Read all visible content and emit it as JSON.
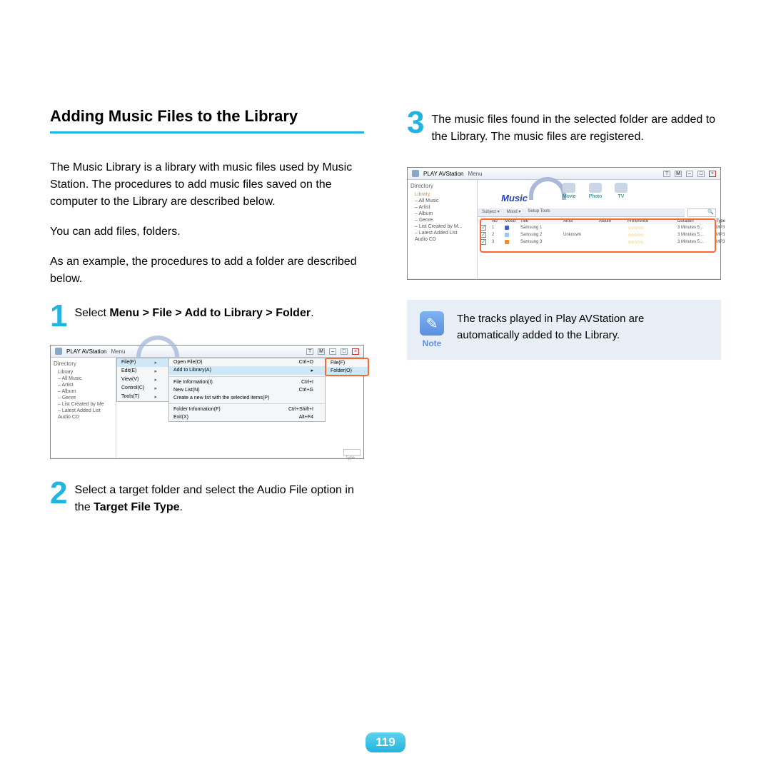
{
  "heading": "Adding Music Files to the Library",
  "intro1": "The Music Library is a library with music files used by Music Station. The procedures to add music files saved on the computer to the Library are described below.",
  "intro2": "You can add files, folders.",
  "intro3": "As an example, the procedures to add a folder are described below.",
  "step1": {
    "num": "1",
    "prefix": "Select ",
    "bold": "Menu > File > Add to Library > Folder",
    "suffix": "."
  },
  "step2": {
    "num": "2",
    "prefix": "Select a target folder and select the Audio File option in the ",
    "bold": "Target File Type",
    "suffix": "."
  },
  "step3": {
    "num": "3",
    "text": "The music files found in the selected folder are added to the Library. The music files are registered."
  },
  "note": {
    "label": "Note",
    "text": "The tracks played in Play AVStation are automatically added to the Library."
  },
  "page_number": "119",
  "shot1": {
    "app_title": "PLAY AVStation",
    "menu_label": "Menu",
    "side_title": "Directory",
    "side_items": [
      "Library",
      "– All Music",
      "– Artist",
      "– Album",
      "– Genre",
      "– List Created by Me",
      "– Latest Added List",
      "Audio CD"
    ],
    "menu1": [
      {
        "label": "File(F)",
        "arrow": "▸"
      },
      {
        "label": "Edit(E)",
        "arrow": "▸"
      },
      {
        "label": "View(V)",
        "arrow": "▸"
      },
      {
        "label": "Control(C)",
        "arrow": "▸"
      },
      {
        "label": "Tools(T)",
        "arrow": "▸"
      }
    ],
    "menu2": [
      {
        "label": "Open File(O)",
        "sc": "Ctrl+O"
      },
      {
        "label": "Add to Library(A)",
        "sc": "▸",
        "hi": true
      },
      {
        "label": "File Information(I)",
        "sc": "Ctrl+I"
      },
      {
        "label": "New List(N)",
        "sc": "Ctrl+G"
      },
      {
        "label": "Create a new list with the selected items(P)",
        "sc": ""
      },
      {
        "label": "Folder Information(F)",
        "sc": "Ctrl+Shift+I"
      },
      {
        "label": "Exit(X)",
        "sc": "Alt+F4"
      }
    ],
    "menu3": [
      {
        "label": "File(F)"
      },
      {
        "label": "Folder(O)",
        "hi": true
      }
    ],
    "search_icon": "🔍",
    "type_label": "Type"
  },
  "shot2": {
    "app_title": "PLAY AVStation",
    "menu_label": "Menu",
    "music_label": "Music",
    "tabs": [
      "Movie",
      "Photo",
      "TV"
    ],
    "side_title": "Directory",
    "side_items": [
      "Library",
      "– All Music",
      "– Artist",
      "– Album",
      "– Genre",
      "– List Created by M...",
      "– Latest Added List",
      "Audio CD"
    ],
    "filters": [
      "Subject ▾",
      "Mood ▾",
      "Setup Tools"
    ],
    "columns": [
      "",
      "No",
      "Mood",
      "Title",
      "Artist",
      "Album",
      "Preference",
      "Duration",
      "Type"
    ],
    "rows": [
      {
        "no": "1",
        "mood": "#3a63d0",
        "title": "Samsung 1",
        "artist": "",
        "album": "",
        "pref": "☆☆☆☆☆",
        "dur": "3 Minutes 5...",
        "type": "MP3"
      },
      {
        "no": "2",
        "mood": "#9cc6f0",
        "title": "Samsung 2",
        "artist": "Unknown",
        "album": "",
        "pref": "☆☆☆☆☆",
        "dur": "3 Minutes 5...",
        "type": "MP3"
      },
      {
        "no": "3",
        "mood": "#f08a2a",
        "title": "Samsung 3",
        "artist": "",
        "album": "",
        "pref": "☆☆☆☆☆",
        "dur": "3 Minutes 5...",
        "type": "MP3"
      }
    ],
    "search_icon": "🔍"
  }
}
